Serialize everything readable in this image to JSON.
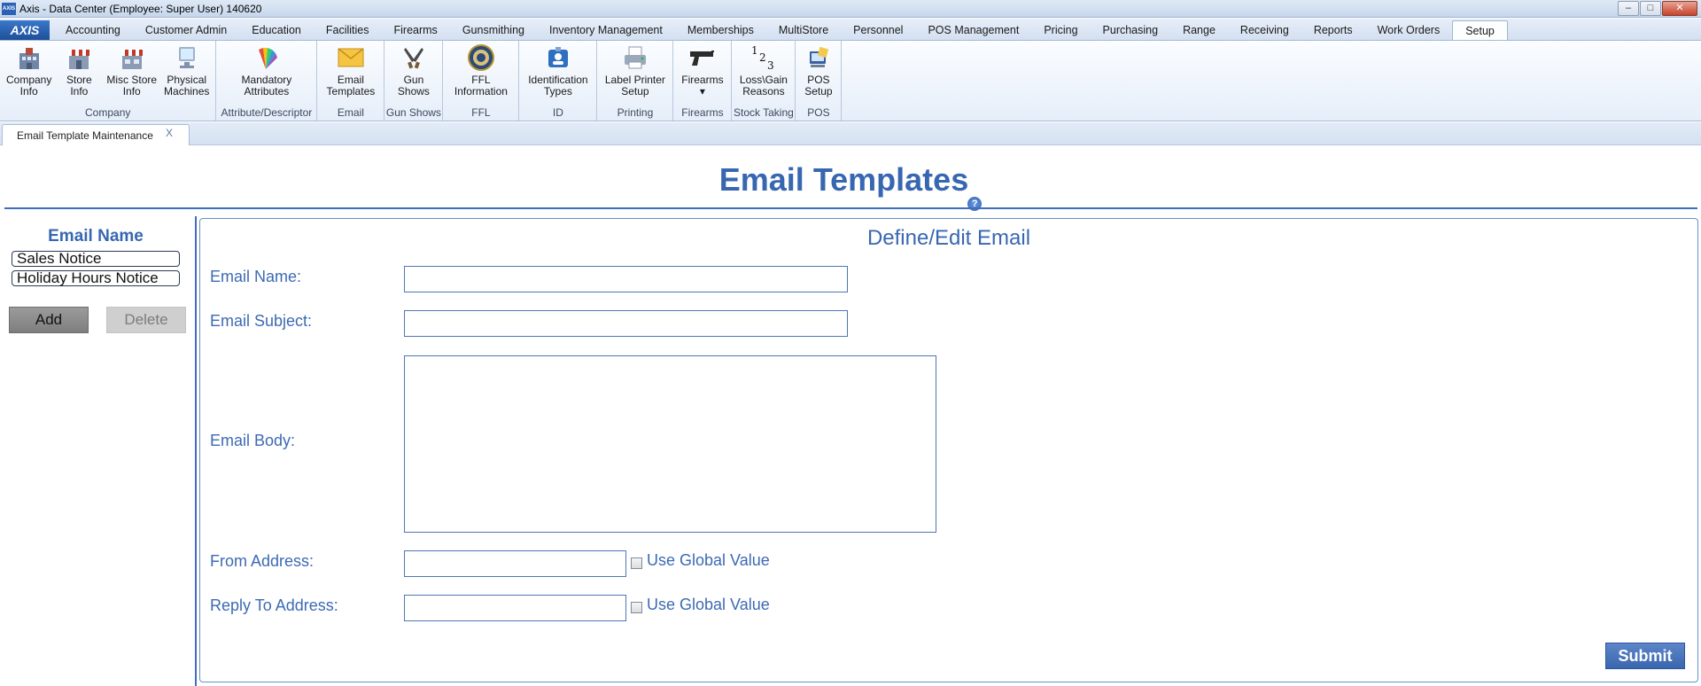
{
  "window": {
    "app_icon_text": "AXIS",
    "title": "Axis - Data Center  (Employee: Super User) 140620",
    "controls": {
      "minimize": "–",
      "maximize": "□",
      "close": "✕"
    }
  },
  "menu": {
    "logo": "AXIS",
    "tabs": [
      {
        "label": "Accounting"
      },
      {
        "label": "Customer Admin"
      },
      {
        "label": "Education"
      },
      {
        "label": "Facilities"
      },
      {
        "label": "Firearms"
      },
      {
        "label": "Gunsmithing"
      },
      {
        "label": "Inventory Management"
      },
      {
        "label": "Memberships"
      },
      {
        "label": "MultiStore"
      },
      {
        "label": "Personnel"
      },
      {
        "label": "POS Management"
      },
      {
        "label": "Pricing"
      },
      {
        "label": "Purchasing"
      },
      {
        "label": "Range"
      },
      {
        "label": "Receiving"
      },
      {
        "label": "Reports"
      },
      {
        "label": "Work Orders"
      },
      {
        "label": "Setup",
        "active": true
      }
    ]
  },
  "ribbon": {
    "groups": [
      {
        "label": "Company",
        "buttons": [
          {
            "label": "Company\nInfo",
            "icon": "building-icon"
          },
          {
            "label": "Store\nInfo",
            "icon": "store-icon"
          },
          {
            "label": "Misc Store\nInfo",
            "icon": "store-misc-icon"
          },
          {
            "label": "Physical\nMachines",
            "icon": "computer-icon"
          }
        ]
      },
      {
        "label": "Attribute/Descriptor",
        "buttons": [
          {
            "label": "Mandatory\nAttributes",
            "icon": "color-swatch-icon"
          }
        ]
      },
      {
        "label": "Email",
        "buttons": [
          {
            "label": "Email\nTemplates",
            "icon": "envelope-icon"
          }
        ]
      },
      {
        "label": "Gun Shows",
        "buttons": [
          {
            "label": "Gun\nShows",
            "icon": "pistols-icon"
          }
        ]
      },
      {
        "label": "FFL",
        "buttons": [
          {
            "label": "FFL\nInformation",
            "icon": "seal-icon"
          }
        ]
      },
      {
        "label": "ID",
        "buttons": [
          {
            "label": "Identification\nTypes",
            "icon": "id-badge-icon"
          }
        ]
      },
      {
        "label": "Printing",
        "buttons": [
          {
            "label": "Label Printer\nSetup",
            "icon": "printer-icon"
          }
        ]
      },
      {
        "label": "Firearms",
        "buttons": [
          {
            "label": "Firearms\n▾",
            "icon": "handgun-icon"
          }
        ]
      },
      {
        "label": "Stock Taking",
        "buttons": [
          {
            "label": "Loss\\Gain\nReasons",
            "icon": "numbers-icon",
            "glyph": "¹₂₃"
          }
        ]
      },
      {
        "label": "POS",
        "buttons": [
          {
            "label": "POS\nSetup",
            "icon": "pos-terminal-icon"
          }
        ]
      }
    ]
  },
  "doc_tab": {
    "label": "Email Template Maintenance",
    "close": "X"
  },
  "page": {
    "title": "Email Templates",
    "help": "?"
  },
  "left": {
    "heading": "Email Name",
    "items": [
      "Sales Notice",
      "Holiday Hours Notice"
    ],
    "add_label": "Add",
    "delete_label": "Delete"
  },
  "form": {
    "heading": "Define/Edit Email",
    "email_name_label": "Email Name:",
    "email_name_value": "",
    "email_subject_label": "Email Subject:",
    "email_subject_value": "",
    "email_body_label": "Email Body:",
    "email_body_value": "",
    "from_label": "From Address:",
    "from_value": "",
    "from_global_label": "Use Global Value",
    "reply_label": "Reply To Address:",
    "reply_value": "",
    "reply_global_label": "Use Global Value",
    "submit_label": "Submit"
  },
  "colors": {
    "accent": "#3867b1",
    "submit": "#3a66ae",
    "add_button": "#8c8c8c",
    "delete_button": "#cfcfcf"
  }
}
